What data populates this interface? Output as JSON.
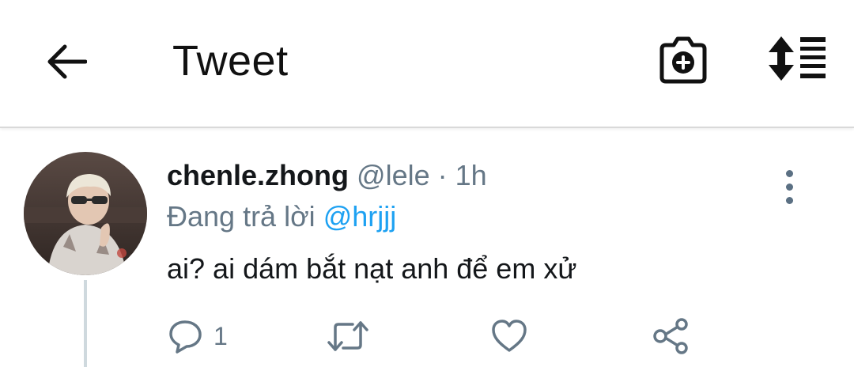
{
  "header": {
    "title": "Tweet",
    "back_icon": "arrow-left-icon",
    "camera_icon": "camera-add-icon",
    "sort_icon": "sort-list-icon"
  },
  "tweet": {
    "author_name": "chenle.zhong",
    "author_handle": "@lele",
    "separator": "·",
    "time": "1h",
    "reply_prefix": "Đang trả lời",
    "reply_to": "@hrjjj",
    "text": "ai? ai dám bắt nạt anh để em xử",
    "reply_count": "1"
  },
  "colors": {
    "accent": "#1da1f2",
    "text_primary": "#14171a",
    "text_secondary": "#657786",
    "divider": "#d9d9d9"
  }
}
